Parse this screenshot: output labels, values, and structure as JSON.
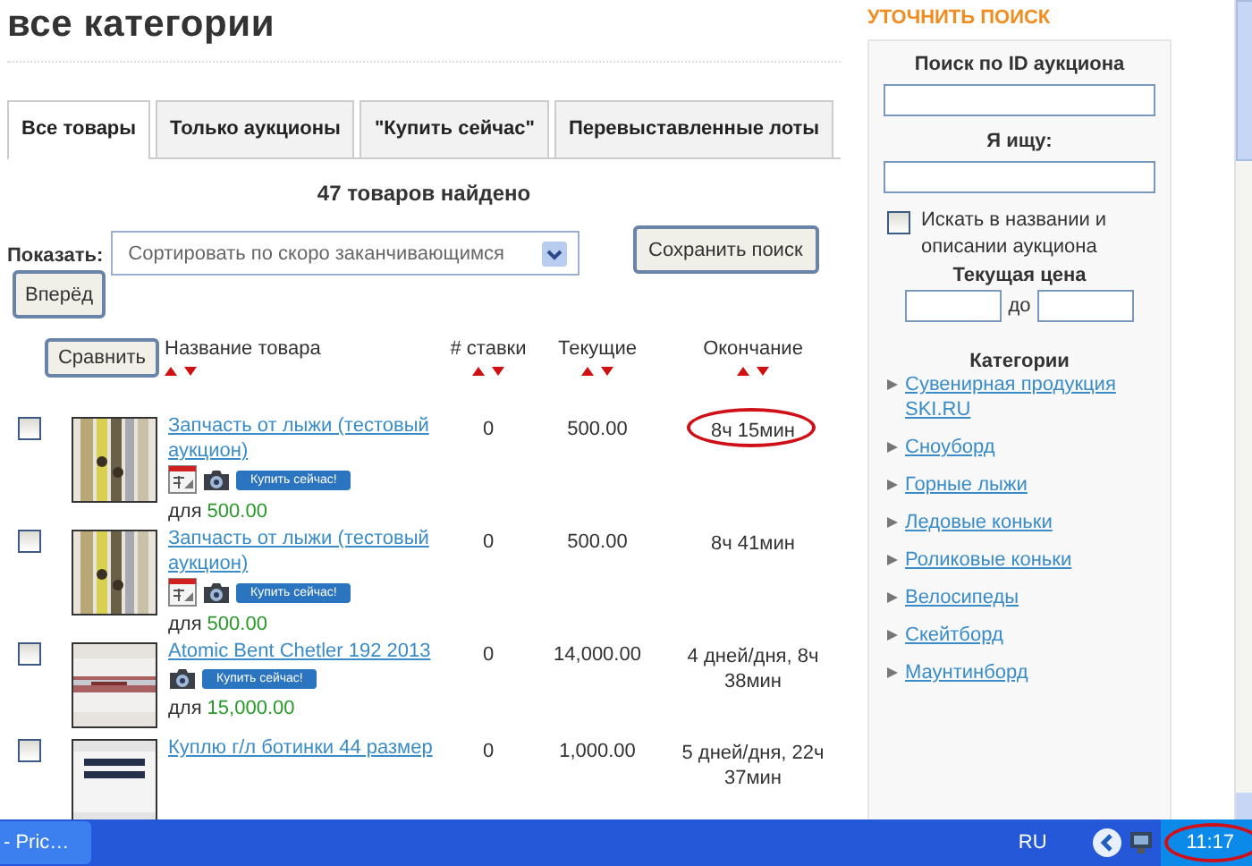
{
  "page_title": "все категории",
  "tabs": [
    {
      "label": "Все товары",
      "selected": true
    },
    {
      "label": "Только аукционы",
      "selected": false
    },
    {
      "label": "\"Купить сейчас\"",
      "selected": false
    },
    {
      "label": "Перевыставленные лоты",
      "selected": false
    }
  ],
  "result_count": "47 товаров найдено",
  "sort": {
    "label": "Показать:",
    "value": "Сортировать по скоро заканчивающимся"
  },
  "save_search_button": "Сохранить поиск",
  "forward_button": "Вперёд",
  "compare_button": "Сравнить",
  "columns": [
    "Название товара",
    "# ставки",
    "Текущие",
    "Окончание"
  ],
  "rows": [
    {
      "checked": false,
      "title": "Запчасть от лыжи (тестовый аукцион)",
      "calendar": true,
      "camera": true,
      "buy_now": "Купить сейчас!",
      "price_prefix": "для",
      "price": "500.00",
      "bids": "0",
      "current": "500.00",
      "ends": "8ч 15мин",
      "highlighted": true
    },
    {
      "checked": false,
      "title": "Запчасть от лыжи (тестовый аукцион)",
      "calendar": true,
      "camera": true,
      "buy_now": "Купить сейчас!",
      "price_prefix": "для",
      "price": "500.00",
      "bids": "0",
      "current": "500.00",
      "ends": "8ч 41мин",
      "highlighted": false
    },
    {
      "checked": false,
      "title": "Atomic Bent Chetler 192 2013",
      "calendar": false,
      "camera": true,
      "buy_now": "Купить сейчас!",
      "price_prefix": "для",
      "price": "15,000.00",
      "bids": "0",
      "current": "14,000.00",
      "ends": "4 дней/дня, 8ч 38мин",
      "highlighted": false
    },
    {
      "checked": false,
      "title": "Куплю г/л ботинки 44 размер",
      "calendar": false,
      "camera": false,
      "bids": "0",
      "current": "1,000.00",
      "ends": "5 дней/дня, 22ч 37мин",
      "highlighted": false
    }
  ],
  "sidebar": {
    "heading": "УТОЧНИТЬ ПОИСК",
    "id_label": "Поиск по ID аукциона",
    "query_label": "Я ищу:",
    "desc_checkbox": {
      "label": "Искать в названии и описании аукциона",
      "checked": false
    },
    "price_label": "Текущая цена",
    "price_to": "до",
    "categories_label": "Категории",
    "categories": [
      "Сувенирная продукция SKI.RU",
      "Сноуборд",
      "Горные лыжи",
      "Ледовые коньки",
      "Роликовые коньки",
      "Велосипеды",
      "Скейтборд",
      "Маунтинборд"
    ]
  },
  "taskbar": {
    "window_button": "- Pric…",
    "language": "RU",
    "clock": "11:17",
    "clock_highlighted": true
  }
}
